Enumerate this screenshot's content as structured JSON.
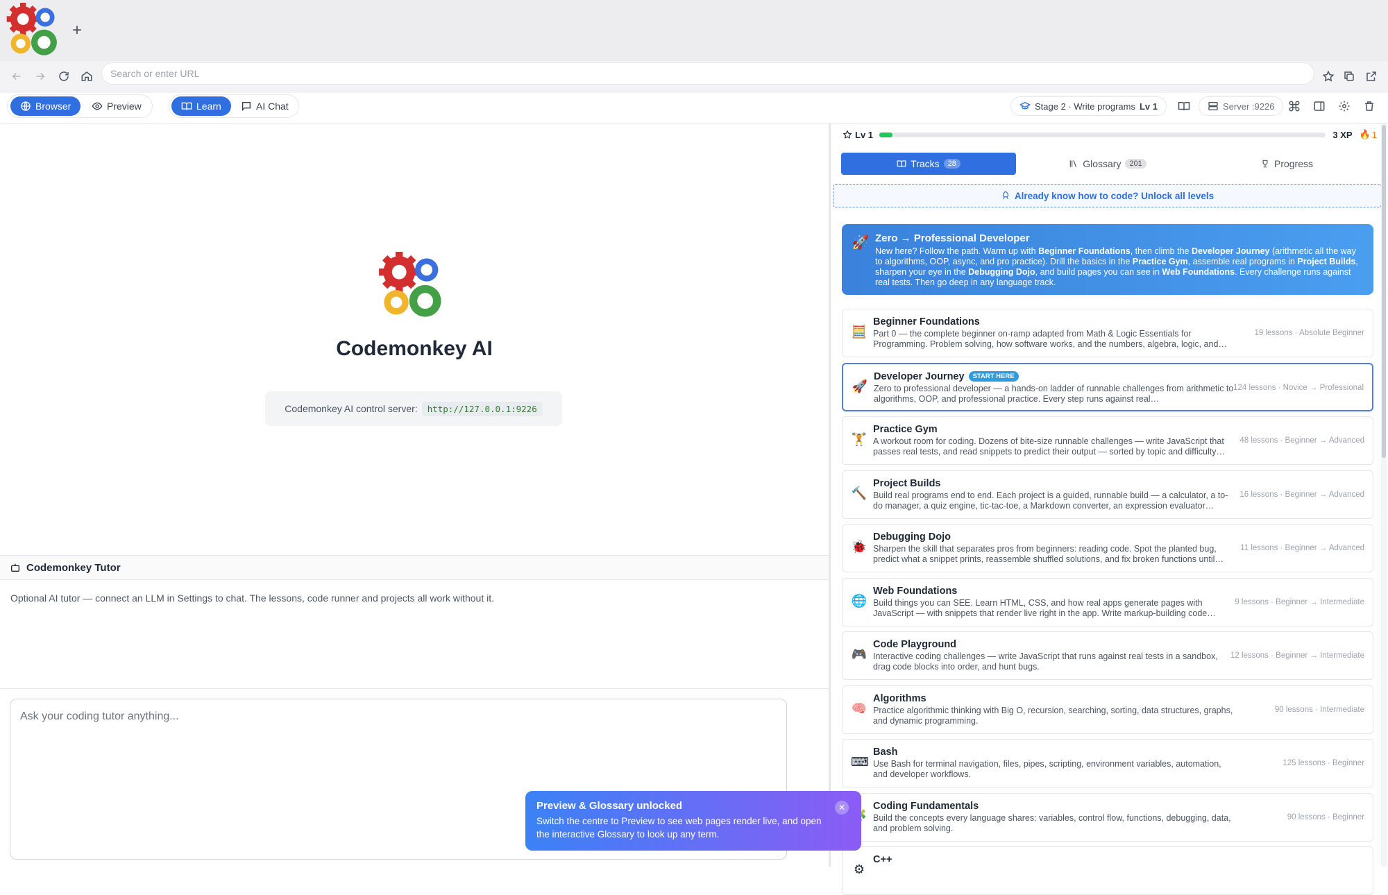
{
  "browser": {
    "new_tab": "+",
    "url_placeholder": "Search or enter URL"
  },
  "toolbar": {
    "modes": [
      {
        "label": "Browser",
        "icon": "globe-icon"
      },
      {
        "label": "Preview",
        "icon": "eye-icon"
      },
      {
        "label": "Learn",
        "icon": "book-icon"
      },
      {
        "label": "AI Chat",
        "icon": "chat-icon"
      }
    ],
    "stage_label": "Stage 2 · Write programs",
    "stage_level": "Lv 1",
    "server_label": "Server :9226",
    "status_color": "#22c55e"
  },
  "main": {
    "app_title": "Codemonkey AI",
    "server_text": "Codemonkey AI control server:",
    "server_url": "http://127.0.0.1:9226"
  },
  "tutor": {
    "title": "Codemonkey Tutor",
    "message": "Optional AI tutor — connect an LLM in Settings to chat. The lessons, code runner and projects all work without it.",
    "input_placeholder": "Ask your coding tutor anything..."
  },
  "progress": {
    "level": "Lv 1",
    "xp": "3 XP",
    "streak": "1",
    "xp_fraction": 0.03
  },
  "tabs": [
    {
      "label": "Tracks",
      "count": "28"
    },
    {
      "label": "Glossary",
      "count": "201"
    },
    {
      "label": "Progress",
      "count": ""
    }
  ],
  "unlock_text": "Already know how to code? Unlock all levels",
  "banner": {
    "title": "Zero → Professional Developer",
    "p1": "New here? Follow the path. Warm up with ",
    "b1": "Beginner Foundations",
    "p2": ", then climb the ",
    "b2": "Developer Journey",
    "p3": " (arithmetic all the way to algorithms, OOP, async, and pro practice). Drill the basics in the ",
    "b3": "Practice Gym",
    "p4": ", assemble real programs in ",
    "b4": "Project Builds",
    "p5": ", sharpen your eye in the ",
    "b5": "Debugging Dojo",
    "p6": ", and build pages you can see in ",
    "b6": "Web Foundations",
    "p7": ". Every challenge runs against real tests. Then go deep in any language track."
  },
  "tracks": [
    {
      "emoji": "🧮",
      "name": "Beginner Foundations",
      "badge": "",
      "desc": "Part 0 — the complete beginner on-ramp adapted from Math & Logic Essentials for Programming. Problem solving, how software works, and the numbers, algebra, logic, and…",
      "meta": "19 lessons · Absolute Beginner"
    },
    {
      "emoji": "🚀",
      "name": "Developer Journey",
      "badge": "START HERE",
      "desc": "Zero to professional developer — a hands-on ladder of runnable challenges from arithmetic to algorithms, OOP, and professional practice. Every step runs against real…",
      "meta": "124 lessons · Novice → Professional"
    },
    {
      "emoji": "🏋",
      "name": "Practice Gym",
      "badge": "",
      "desc": "A workout room for coding. Dozens of bite-size runnable challenges — write JavaScript that passes real tests, and read snippets to predict their output — sorted by topic and difficulty…",
      "meta": "48 lessons · Beginner → Advanced"
    },
    {
      "emoji": "🔨",
      "name": "Project Builds",
      "badge": "",
      "desc": "Build real programs end to end. Each project is a guided, runnable build — a calculator, a to-do manager, a quiz engine, tic-tac-toe, a Markdown converter, an expression evaluator…",
      "meta": "16 lessons · Beginner → Advanced"
    },
    {
      "emoji": "🐞",
      "name": "Debugging Dojo",
      "badge": "",
      "desc": "Sharpen the skill that separates pros from beginners: reading code. Spot the planted bug, predict what a snippet prints, reassemble shuffled solutions, and fix broken functions until…",
      "meta": "11 lessons · Beginner → Advanced"
    },
    {
      "emoji": "🌐",
      "name": "Web Foundations",
      "badge": "",
      "desc": "Build things you can SEE. Learn HTML, CSS, and how real apps generate pages with JavaScript — with snippets that render live right in the app. Write markup-building code…",
      "meta": "9 lessons · Beginner → Intermediate"
    },
    {
      "emoji": "🎮",
      "name": "Code Playground",
      "badge": "",
      "desc": "Interactive coding challenges — write JavaScript that runs against real tests in a sandbox, drag code blocks into order, and hunt bugs.",
      "meta": "12 lessons · Beginner → Intermediate"
    },
    {
      "emoji": "🧠",
      "name": "Algorithms",
      "badge": "",
      "desc": "Practice algorithmic thinking with Big O, recursion, searching, sorting, data structures, graphs, and dynamic programming.",
      "meta": "90 lessons · Intermediate"
    },
    {
      "emoji": "⌨",
      "name": "Bash",
      "badge": "",
      "desc": "Use Bash for terminal navigation, files, pipes, scripting, environment variables, automation, and developer workflows.",
      "meta": "125 lessons · Beginner"
    },
    {
      "emoji": "🧩",
      "name": "Coding Fundamentals",
      "badge": "",
      "desc": "Build the concepts every language shares: variables, control flow, functions, debugging, data, and problem solving.",
      "meta": "90 lessons · Beginner"
    },
    {
      "emoji": "⚙",
      "name": "C++",
      "badge": "",
      "desc": "",
      "meta": ""
    }
  ],
  "toast": {
    "title": "Preview & Glossary unlocked",
    "desc": "Switch the centre to Preview to see web pages render live, and open the interactive Glossary to look up any term."
  }
}
